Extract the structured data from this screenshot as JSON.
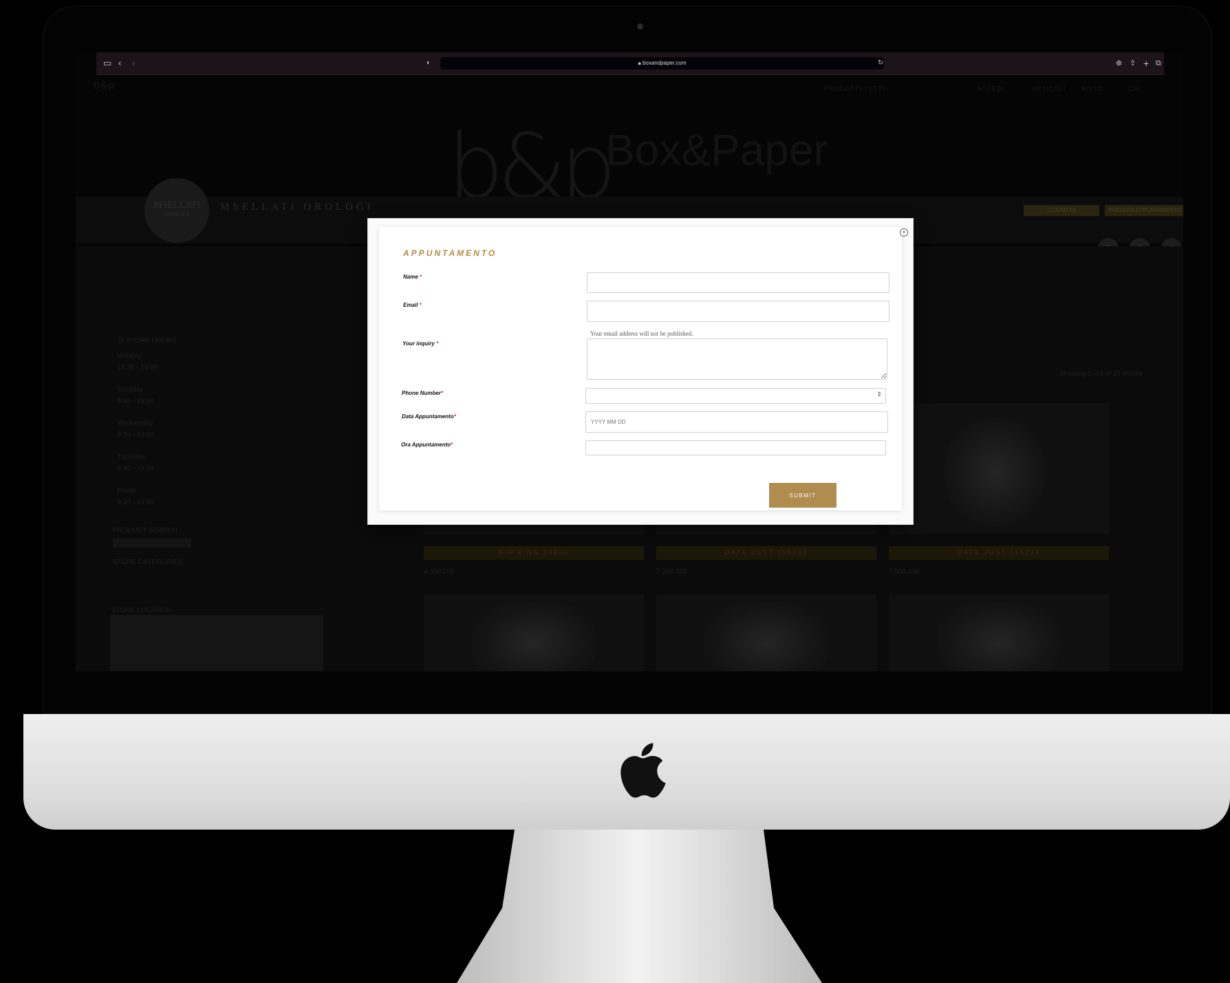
{
  "browser": {
    "url": "boxandpaper.com"
  },
  "site": {
    "brand_mark": "b&p",
    "brand_name": "Box&Paper",
    "nav_left": "PRODOTTI  TUTTI",
    "nav_right": [
      "ACCEDI",
      "ARTICOLI",
      "AIUTO",
      "CHI"
    ],
    "store_logo": "MSELLATI",
    "store_logo_sub": "OROLOGI",
    "store_name": "MSELLATI OROLOGI",
    "buttons": [
      "CONTATTA",
      "PRENOTA APPUNTAMENTO"
    ],
    "store_hours_title": "STORE HOURS",
    "store_hours": [
      {
        "day": "Monday",
        "time": "15:30 - 19:30"
      },
      {
        "day": "Tuesday",
        "time": "9:30 - 19:30"
      },
      {
        "day": "Wednesday",
        "time": "9:30 - 19:30"
      },
      {
        "day": "Thursday",
        "time": "9:30 - 19:30"
      },
      {
        "day": "Friday",
        "time": "9:30 - 19:30"
      }
    ],
    "product_search_title": "PRODUCT SEARCH",
    "store_categories_title": "STORE CATEGORIES",
    "store_location_title": "STORE LOCATION",
    "results_text": "Showing 1–12 of 20 results",
    "products": [
      {
        "name": "AIR KING 14000",
        "price": "4.000,00€"
      },
      {
        "name": "DATE JUST 116200",
        "price": "7.200,00€"
      },
      {
        "name": "DATE JUST 116234",
        "price": "7.500,00€"
      }
    ]
  },
  "modal": {
    "title": "APPUNTAMENTO",
    "close_label": "×",
    "fields": {
      "name_label": "Name",
      "email_label": "Email",
      "email_help": "Your email address will not be published.",
      "inquiry_label": "Your inquiry",
      "phone_label": "Phone Number",
      "date_label": "Data Appuntamento",
      "date_placeholder": "YYYY MM DD",
      "time_label": "Ora Appuntamento",
      "required_mark": "*"
    },
    "submit_label": "SUBMIT"
  },
  "colors": {
    "accent_gold": "#b08c4f",
    "title_gold": "#b6893e",
    "required_red": "#c0392b"
  }
}
